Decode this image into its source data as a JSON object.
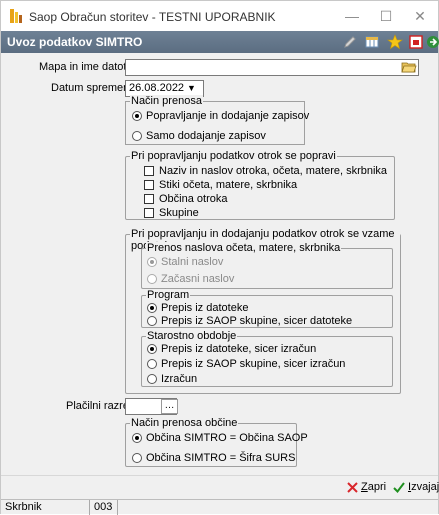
{
  "window": {
    "title": "Saop Obračun storitev - TESTNI UPORABNIK",
    "controls": {
      "minimize": "—",
      "maximize": "☐",
      "close": "✕"
    }
  },
  "header": {
    "title": "Uvoz podatkov SIMTRO",
    "icons": [
      "edit-icon",
      "columns-icon",
      "favorite-star-icon",
      "pdf-icon",
      "exit-icon"
    ]
  },
  "form": {
    "file_label": "Mapa in ime datoteke",
    "file_value": "",
    "date_label": "Datum spremembe",
    "date_value": "26.08.2022",
    "transfer_mode": {
      "legend": "Način prenosa",
      "options": [
        "Popravljanje in dodajanje zapisov",
        "Samo dodajanje zapisov"
      ],
      "selected": 0
    },
    "fix_group": {
      "legend": "Pri popravljanju podatkov otrok se popravi",
      "checks": [
        "Naziv in naslov otroka, očeta, matere, skrbnika",
        "Stiki očeta, matere, skrbnika",
        "Občina otroka",
        "Skupine"
      ]
    },
    "take_group": {
      "legend": "Pri popravljanju in dodajanju podatkov otrok se vzame podatek",
      "address": {
        "legend": "Prenos naslova očeta, matere, skrbnika",
        "options": [
          "Stalni naslov",
          "Začasni naslov"
        ],
        "selected": 0
      },
      "program": {
        "legend": "Program",
        "options": [
          "Prepis iz datoteke",
          "Prepis iz SAOP skupine, sicer datoteke"
        ],
        "selected": 0
      },
      "age": {
        "legend": "Starostno obdobje",
        "options": [
          "Prepis iz datoteke, sicer izračun",
          "Prepis iz SAOP skupine, sicer izračun",
          "Izračun"
        ],
        "selected": 0
      }
    },
    "pay_class_label": "Plačilni razred",
    "pay_class_value": "",
    "municipality": {
      "legend": "Način prenosa občine",
      "options": [
        "Občina SIMTRO = Občina SAOP",
        "Občina SIMTRO = Šifra SURS"
      ],
      "selected": 0
    }
  },
  "footer": {
    "cancel": {
      "underline": "Z",
      "rest": "apri"
    },
    "confirm": {
      "underline": "I",
      "rest": "zvajaj"
    }
  },
  "status": {
    "role": "Skrbnik",
    "code": "003"
  },
  "colors": {
    "header_bg": "#5f7185",
    "cancel_x": "#d9262b",
    "confirm_check": "#1f8f1f"
  }
}
